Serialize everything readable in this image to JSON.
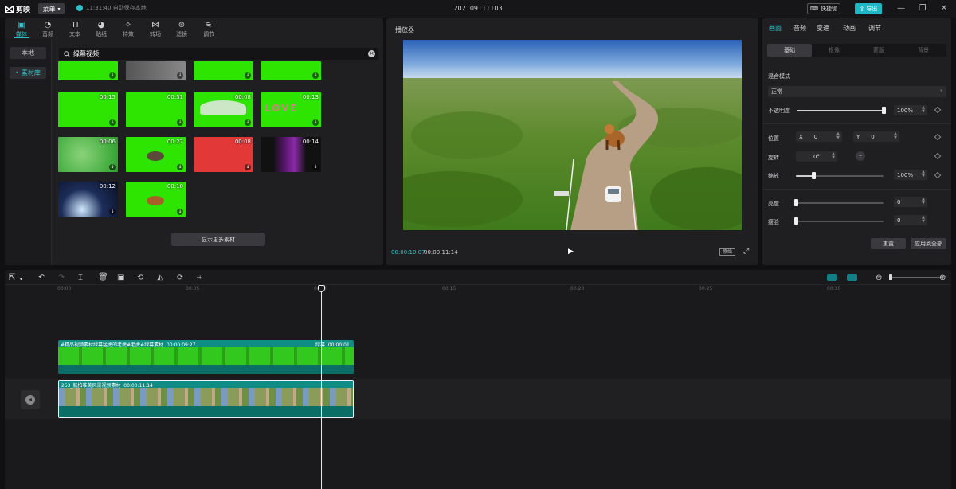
{
  "app": {
    "name": "剪映",
    "menu_label": "菜单",
    "autosave_text": "11:31:40 自动保存本地",
    "project_title": "202109111103",
    "shortcut_label": "快捷键",
    "export_label": "导出"
  },
  "media": {
    "categories": [
      {
        "label": "媒体",
        "icon": "media-icon"
      },
      {
        "label": "音频",
        "icon": "audio-icon"
      },
      {
        "label": "文本",
        "icon": "text-icon"
      },
      {
        "label": "贴纸",
        "icon": "sticker-icon"
      },
      {
        "label": "特效",
        "icon": "effects-icon"
      },
      {
        "label": "转场",
        "icon": "transition-icon"
      },
      {
        "label": "滤镜",
        "icon": "filter-icon"
      },
      {
        "label": "调节",
        "icon": "adjust-icon"
      }
    ],
    "side_nav": [
      "本地",
      "素材库"
    ],
    "search_value": "绿幕视频",
    "thumbnails": [
      {
        "duration": "",
        "kind": "partial-dark"
      },
      {
        "duration": "",
        "kind": "partial-gray"
      },
      {
        "duration": "",
        "kind": "partial"
      },
      {
        "duration": "",
        "kind": "partial"
      },
      {
        "duration": "00:15",
        "kind": "leaves"
      },
      {
        "duration": "00:31",
        "kind": "particles"
      },
      {
        "duration": "00:08",
        "kind": "wings"
      },
      {
        "duration": "00:13",
        "kind": "love"
      },
      {
        "duration": "00:06",
        "kind": "explosion"
      },
      {
        "duration": "00:27",
        "kind": "animal"
      },
      {
        "duration": "00:08",
        "kind": "red"
      },
      {
        "duration": "00:14",
        "kind": "purple"
      },
      {
        "duration": "00:12",
        "kind": "light"
      },
      {
        "duration": "00:10",
        "kind": "tiger"
      }
    ],
    "love_text": "LOVE",
    "more_button": "显示更多素材"
  },
  "player": {
    "title": "播放器",
    "current_time": "00:00:10:07",
    "total_time": "00:00:11:14",
    "ratio_label": "原始"
  },
  "props": {
    "tabs": [
      "画面",
      "音频",
      "变速",
      "动画",
      "调节"
    ],
    "subtabs": [
      "基础",
      "抠像",
      "蒙版",
      "背景"
    ],
    "blend_mode_label": "混合模式",
    "blend_mode_value": "正常",
    "opacity_label": "不透明度",
    "opacity_value": "100%",
    "opacity_level": 1.0,
    "position_label": "位置",
    "pos_x_label": "X",
    "pos_x_value": "0",
    "pos_y_label": "Y",
    "pos_y_value": "0",
    "rotate_label": "旋转",
    "rotate_value": "0°",
    "scale_label": "缩放",
    "scale_value": "100%",
    "scale_level": 0.2,
    "brightness_label": "亮度",
    "brightness_value": "0",
    "contrast_label": "瘦脸",
    "contrast_value": "0",
    "reset_label": "重置",
    "apply_all_label": "应用到全部"
  },
  "timeline": {
    "ticks": [
      "00:00",
      "00:05",
      "00:10",
      "00:15",
      "00:20",
      "00:25",
      "00:30"
    ],
    "clip_top_label": "#精品视频素材绿幕猛虎的老虎#老虎#绿幕素材",
    "clip_top_duration": "00:00:09:27",
    "clip_top_tail_label": "绿幕",
    "clip_top_tail_duration": "00:00:01",
    "clip_main_label": "253_航拍唯美风景视频素材",
    "clip_main_duration": "00:00:11:14"
  },
  "colors": {
    "accent": "#2ec2c8",
    "green_screen": "#2de500",
    "clip_teal": "#0f8c83"
  }
}
